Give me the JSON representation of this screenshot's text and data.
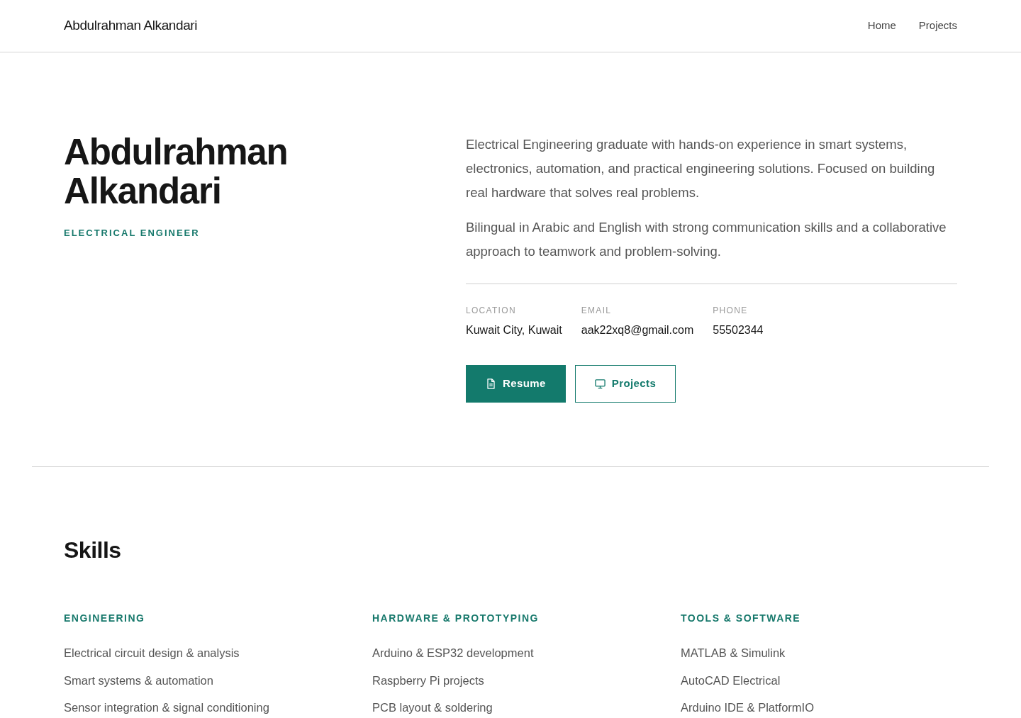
{
  "navbar": {
    "brand": "Abdulrahman Alkandari",
    "links": [
      "Home",
      "Projects"
    ]
  },
  "hero": {
    "name": "Abdulrahman Alkandari",
    "role": "ELECTRICAL ENGINEER",
    "about": [
      "Electrical Engineering graduate with hands-on experience in smart systems, electronics, automation, and practical engineering solutions. Focused on building real hardware that solves real problems.",
      "Bilingual in Arabic and English with strong communication skills and a collaborative approach to teamwork and problem-solving."
    ],
    "contact": [
      {
        "label": "LOCATION",
        "value": "Kuwait City, Kuwait"
      },
      {
        "label": "EMAIL",
        "value": "aak22xq8@gmail.com"
      },
      {
        "label": "PHONE",
        "value": "55502344"
      }
    ],
    "buttons": [
      {
        "label": "Resume",
        "kind": "primary"
      },
      {
        "label": "Projects",
        "kind": "secondary"
      }
    ]
  },
  "skills": {
    "title": "Skills",
    "groups": [
      {
        "title": "ENGINEERING",
        "items": [
          "Electrical circuit design & analysis",
          "Smart systems & automation",
          "Sensor integration & signal conditioning"
        ]
      },
      {
        "title": "HARDWARE & PROTOTYPING",
        "items": [
          "Arduino & ESP32 development",
          "Raspberry Pi projects",
          "PCB layout & soldering"
        ]
      },
      {
        "title": "TOOLS & SOFTWARE",
        "items": [
          "MATLAB & Simulink",
          "AutoCAD Electrical",
          "Arduino IDE & PlatformIO"
        ]
      }
    ]
  }
}
